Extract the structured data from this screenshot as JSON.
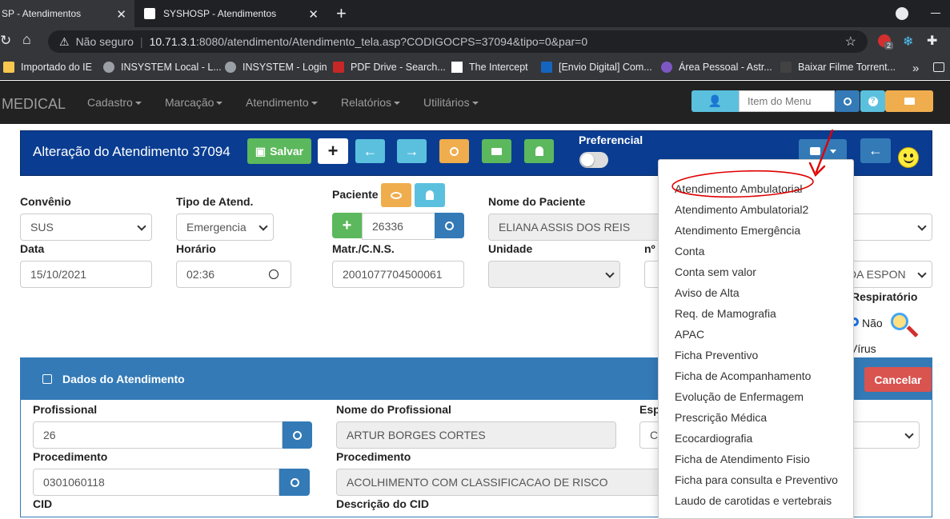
{
  "browser": {
    "tabs": [
      {
        "title": "SP - Atendimentos",
        "active": true
      },
      {
        "title": "SYSHOSP - Atendimentos",
        "active": false
      }
    ],
    "security": "Não seguro",
    "url_host": "10.71.3.1",
    "url_rest": ":8080/atendimento/Atendimento_tela.asp?CODIGOCPS=37094&tipo=0&par=0",
    "ext_badge": "2",
    "bookmarks": [
      "Importado do IE",
      "INSYSTEM Local - L...",
      "INSYSTEM - Login",
      "PDF Drive - Search...",
      "The Intercept",
      "[Envio Digital] Com...",
      "Área Pessoal - Astr...",
      "Baixar Filme Torrent..."
    ],
    "more": "»"
  },
  "navbar": {
    "brand": "MEDICAL",
    "items": [
      "Cadastro",
      "Marcação",
      "Atendimento",
      "Relatórios",
      "Utilitários"
    ],
    "search_placeholder": "Item do Menu"
  },
  "header": {
    "title": "Alteração do Atendimento 37094",
    "save_label": "Salvar",
    "preferencial_label": "Preferencial"
  },
  "form": {
    "convenio": {
      "label": "Convênio",
      "value": "SUS"
    },
    "tipo": {
      "label": "Tipo de Atend.",
      "value": "Emergencia"
    },
    "paciente": {
      "label": "Paciente",
      "value": "26336"
    },
    "nome_paciente": {
      "label": "Nome do Paciente",
      "value": "ELIANA ASSIS DOS REIS"
    },
    "data": {
      "label": "Data",
      "value": "15/10/2021"
    },
    "horario": {
      "label": "Horário",
      "value": "02:36"
    },
    "matr": {
      "label": "Matr./C.N.S.",
      "value": "2001077704500061"
    },
    "unidade": {
      "label": "Unidade",
      "value": ""
    },
    "num_label": "nº",
    "right_select_value": "DA ESPON",
    "respiratorio_label": "Respiratório",
    "nao_label": "Não",
    "virus_label": "Vírus"
  },
  "dados": {
    "title": "Dados do Atendimento",
    "cancel_label": "Cancelar",
    "profissional": {
      "label": "Profissional",
      "value": "26"
    },
    "nome_profissional": {
      "label": "Nome do Profissional",
      "value": "ARTUR BORGES CORTES"
    },
    "esp_label": "Esp",
    "esp_value": "C",
    "procedimento": {
      "label": "Procedimento",
      "value": "0301060118"
    },
    "procedimento_desc": {
      "label": "Procedimento",
      "value": "ACOLHIMENTO COM CLASSIFICACAO DE RISCO"
    },
    "cid_label": "CID",
    "desc_cid_label": "Descrição do CID"
  },
  "print_menu": [
    "Atendimento Ambulatorial",
    "Atendimento Ambulatorial2",
    "Atendimento Emergência",
    "Conta",
    "Conta sem valor",
    "Aviso de Alta",
    "Req. de Mamografia",
    "APAC",
    "Ficha Preventivo",
    "Ficha de Acompanhamento",
    "Evolução de Enfermagem",
    "Prescrição Médica",
    "Ecocardiografia",
    "Ficha de Atendimento Fisio",
    "Ficha para consulta e Preventivo",
    "Laudo de carotidas e vertebrais"
  ],
  "colors": {
    "header_bg": "#0a3d91",
    "panel_blue": "#337ab7",
    "success": "#5cb85c",
    "info": "#5bc0de",
    "warning": "#f0ad4e",
    "danger": "#d9534f",
    "annotation": "#e00000"
  }
}
